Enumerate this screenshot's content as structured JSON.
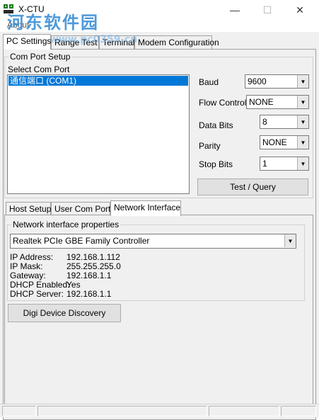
{
  "window": {
    "title": "X-CTU",
    "minimize_glyph": "—",
    "maximize_glyph": "☐",
    "close_glyph": "✕"
  },
  "menu": {
    "about": "About"
  },
  "watermark": {
    "logo": "河东软件园",
    "url": "www.pc0359.cn"
  },
  "tabs": [
    {
      "label": "PC Settings",
      "active": true
    },
    {
      "label": "Range Test",
      "active": false
    },
    {
      "label": "Terminal",
      "active": false
    },
    {
      "label": "Modem Configuration",
      "active": false
    }
  ],
  "com_port_setup": {
    "group_title": "Com Port Setup",
    "select_label": "Select Com Port",
    "ports": [
      "通信端口 (COM1)"
    ],
    "selected_index": 0,
    "fields": [
      {
        "label": "Baud",
        "value": "9600"
      },
      {
        "label": "Flow Control",
        "value": "NONE"
      },
      {
        "label": "Data Bits",
        "value": "8"
      },
      {
        "label": "Parity",
        "value": "NONE"
      },
      {
        "label": "Stop Bits",
        "value": "1"
      }
    ],
    "test_button": "Test / Query"
  },
  "lower_tabs": [
    {
      "label": "Host Setup",
      "active": false
    },
    {
      "label": "User Com Ports",
      "active": false
    },
    {
      "label": "Network Interface",
      "active": true
    }
  ],
  "network": {
    "group_title": "Network interface properties",
    "adapter": "Realtek PCIe GBE Family Controller",
    "info": [
      {
        "label": "IP Address:",
        "value": "192.168.1.112"
      },
      {
        "label": "IP Mask:",
        "value": "255.255.255.0"
      },
      {
        "label": "Gateway:",
        "value": "192.168.1.1"
      },
      {
        "label": "DHCP Enabled:",
        "value": "Yes"
      },
      {
        "label": "DHCP Server:",
        "value": "192.168.1.1"
      }
    ],
    "discovery_button": "Digi Device Discovery"
  },
  "icons": {
    "dropdown": "▼",
    "app": "app-icon"
  },
  "colors": {
    "selection": "#0078d7",
    "watermark": "#3b8fd6"
  }
}
